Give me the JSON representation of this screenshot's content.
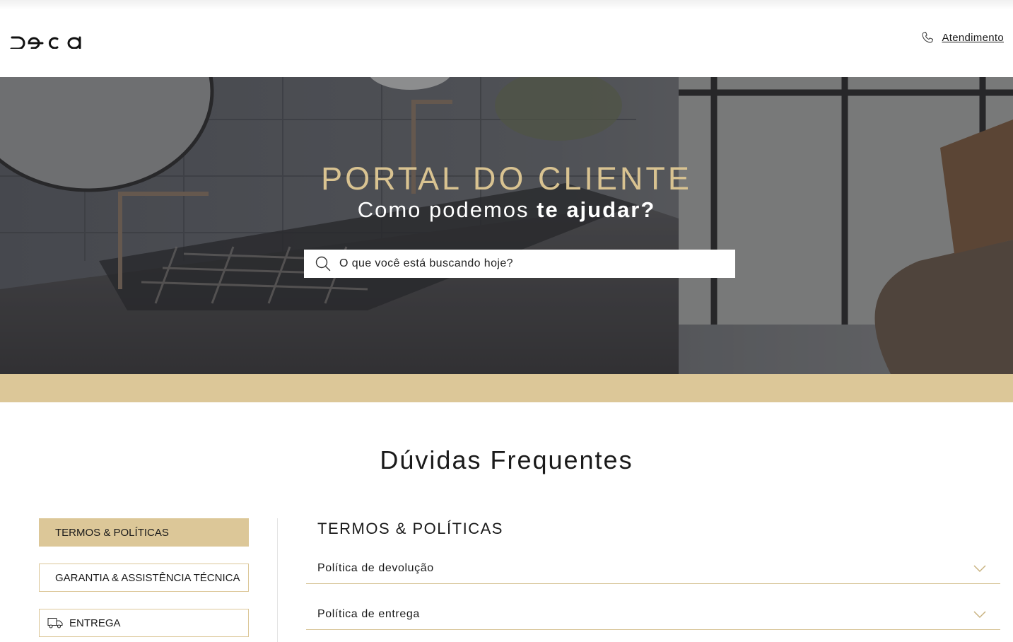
{
  "header": {
    "logo_text": "Deca",
    "support_label": "Atendimento",
    "icons": {
      "phone": "phone-icon"
    }
  },
  "hero": {
    "title": "PORTAL DO CLIENTE",
    "subtitle_regular": "Como podemos ",
    "subtitle_bold": "te ajudar?",
    "search": {
      "placeholder": "O que você está buscando hoje?",
      "value": ""
    }
  },
  "faq": {
    "title": "Dúvidas Frequentes",
    "categories": [
      {
        "label": "TERMOS & POLÍTICAS",
        "active": true
      },
      {
        "label": "GARANTIA & ASSISTÊNCIA TÉCNICA",
        "active": false
      },
      {
        "label": "ENTREGA",
        "active": false,
        "icon": "truck-icon"
      }
    ],
    "section_title": "TERMOS & POLÍTICAS",
    "questions": [
      {
        "label": "Política de devolução"
      },
      {
        "label": "Política de entrega"
      }
    ]
  },
  "colors": {
    "accent_gold": "#dcc798",
    "title_gold": "#d9c391",
    "text": "#1a1a1a"
  }
}
